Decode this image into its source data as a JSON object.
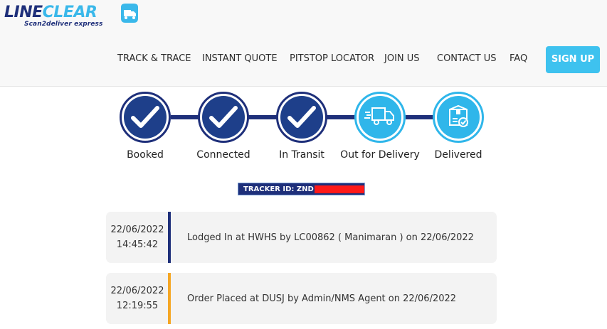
{
  "brand": {
    "name_part1": "LINE",
    "name_part2": "CLEAR",
    "tagline": "Scan2deliver express",
    "primary_color": "#1e2f7a",
    "accent_color": "#3ab8ea"
  },
  "nav": {
    "items": [
      {
        "label": "TRACK & TRACE"
      },
      {
        "label": "INSTANT QUOTE"
      },
      {
        "label": "PITSTOP LOCATOR"
      },
      {
        "label": "JOIN US"
      },
      {
        "label": "CONTACT US"
      },
      {
        "label": "FAQ"
      }
    ],
    "signup_label": "SIGN UP"
  },
  "stepper": {
    "steps": [
      {
        "label": "Booked",
        "status": "done",
        "icon": "check-icon"
      },
      {
        "label": "Connected",
        "status": "done",
        "icon": "check-icon"
      },
      {
        "label": "In Transit",
        "status": "done",
        "icon": "check-icon"
      },
      {
        "label": "Out for Delivery",
        "status": "pending",
        "icon": "delivery-truck-icon"
      },
      {
        "label": "Delivered",
        "status": "pending",
        "icon": "package-delivered-icon"
      }
    ],
    "done_color": "#1e2f7a",
    "pending_color": "#2fb6ea"
  },
  "tracker": {
    "label": "TRACKER ID: ZND"
  },
  "events": [
    {
      "date": "22/06/2022",
      "time": "14:45:42",
      "description": "Lodged In at HWHS by LC00862 ( Manimaran ) on 22/06/2022",
      "bar_color": "#1e2f7a"
    },
    {
      "date": "22/06/2022",
      "time": "12:19:55",
      "description": "Order Placed at DUSJ by Admin/NMS Agent on 22/06/2022",
      "bar_color": "#f5a623"
    }
  ]
}
